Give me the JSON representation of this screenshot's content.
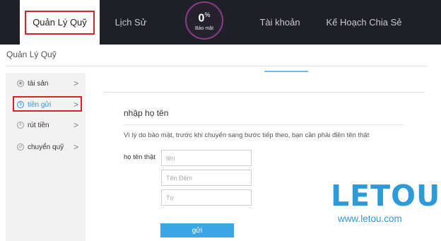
{
  "nav": {
    "fund_management": "Quản Lý Quỹ",
    "history": "Lịch Sử",
    "security_percent": "0",
    "percent_sign": "%",
    "security_label": "Bảo mật",
    "account": "Tài khoản",
    "share_plan": "Kế Hoạch Chia Sẻ"
  },
  "page": {
    "title": "Quản Lý Quỹ"
  },
  "sidebar": {
    "items": [
      {
        "label": "tài sản",
        "icon": "wallet-icon"
      },
      {
        "label": "tiền gửi",
        "icon": "dollar-icon"
      },
      {
        "label": "rút tiền",
        "icon": "withdraw-icon"
      },
      {
        "label": "chuyển quỹ",
        "icon": "transfer-icon"
      }
    ],
    "chevron": ">"
  },
  "form": {
    "heading": "nhập họ tên",
    "notice": "Vì lý do bảo mật, trước khi chuyển sang bước tiếp theo, bạn cần phải điền tên thật",
    "name_label": "họ tên thật",
    "first_name_placeholder": "tên",
    "middle_name_placeholder": "Tên Đệm",
    "last_name_placeholder": "Tọ",
    "submit_label": "gửi"
  },
  "brand": {
    "logo_text": "LETOU",
    "url_text": "www.letou.com",
    "accent_color": "#2e9ad8",
    "highlight_color": "#d3242c"
  }
}
